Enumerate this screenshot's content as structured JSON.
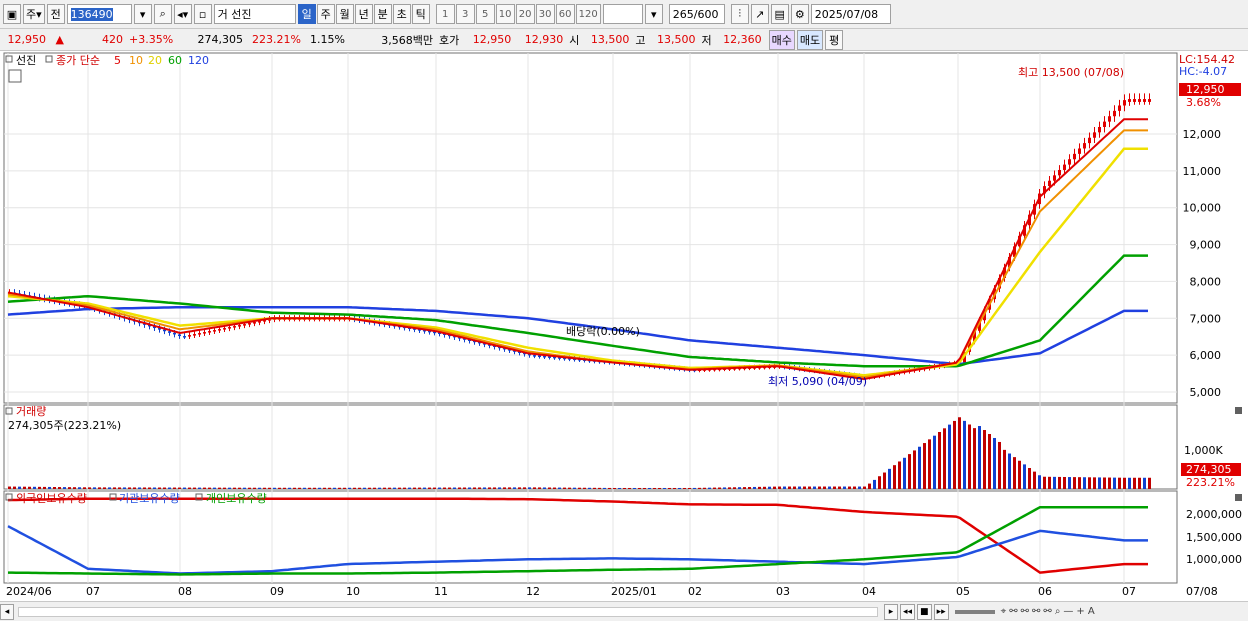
{
  "toolbar": {
    "type_label": "주",
    "prefix_label": "전",
    "code": "136490",
    "name_prefix": "거",
    "name": "선진",
    "period_buttons": [
      "일",
      "주",
      "월",
      "년",
      "분",
      "초",
      "틱"
    ],
    "interval_buttons": [
      "1",
      "3",
      "5",
      "10",
      "20",
      "30",
      "60",
      "120"
    ],
    "count": "265",
    "count_total": "/600",
    "date": "2025/07/08"
  },
  "quote": {
    "price": "12,950",
    "arrow": "▲",
    "change": "420",
    "change_pct": "+3.35%",
    "volume": "274,305",
    "volume_ratio": "223.21%",
    "turnover": "1.15%",
    "amount": "3,568백만",
    "ask_label": "호가",
    "ask1": "12,950",
    "bid1": "12,930",
    "open_label": "시",
    "open": "13,500",
    "high_label": "고",
    "high": "13,500",
    "low_label": "저",
    "low": "12,360",
    "buy_label": "매수",
    "sell_label": "매도",
    "eval_label": "평"
  },
  "legend": {
    "name": "선진",
    "ma_label": "종가 단순",
    "ma_periods": [
      "5",
      "10",
      "20",
      "60",
      "120"
    ],
    "ma_colors": [
      "#e00000",
      "#f09000",
      "#f0e000",
      "#00a000",
      "#2040e0"
    ]
  },
  "annotations": {
    "high": "최고 13,500 (07/08)",
    "low": "최저 5,090 (04/09)",
    "dividend": "배당락(0.00%)",
    "lc": "LC:154.42",
    "hc": "HC:-4.07",
    "last_price": "12,950",
    "last_pct": "3.68%"
  },
  "volume_panel": {
    "title": "거래량",
    "value": "274,305주(223.21%)",
    "tick": "1,000K",
    "last": "274,305",
    "last_pct": "223.21%"
  },
  "holdings_panel": {
    "series": [
      "외국인보유수량",
      "기관보유수량",
      "개인보유수량"
    ],
    "colors": [
      "#e00000",
      "#2050e0",
      "#00a000"
    ],
    "ticks": [
      "2,000,000",
      "1,500,000",
      "1,000,000"
    ]
  },
  "xaxis": {
    "labels": [
      "2024/06",
      "07",
      "08",
      "09",
      "10",
      "11",
      "12",
      "2025/01",
      "02",
      "03",
      "04",
      "05",
      "06",
      "07"
    ],
    "last": "07/08"
  },
  "chart_data": [
    {
      "type": "line",
      "title": "선진",
      "ylim": [
        4700,
        14200
      ],
      "yticks": [
        5000,
        6000,
        7000,
        8000,
        9000,
        10000,
        11000,
        12000
      ],
      "x": [
        "2024/06",
        "07",
        "08",
        "09",
        "10",
        "11",
        "12",
        "2025/01",
        "02",
        "03",
        "04",
        "05",
        "06",
        "07"
      ],
      "series": [
        {
          "name": "종가",
          "values": [
            7700,
            7300,
            6500,
            7000,
            7000,
            6600,
            6000,
            5800,
            5600,
            5700,
            5400,
            5800,
            10500,
            12950
          ]
        },
        {
          "name": "5",
          "values": [
            7700,
            7300,
            6600,
            7000,
            7000,
            6650,
            6050,
            5800,
            5600,
            5700,
            5350,
            5800,
            10300,
            12400
          ]
        },
        {
          "name": "10",
          "values": [
            7650,
            7350,
            6700,
            7000,
            7000,
            6700,
            6100,
            5800,
            5620,
            5720,
            5400,
            5800,
            9900,
            12100
          ]
        },
        {
          "name": "20",
          "values": [
            7600,
            7400,
            6800,
            7000,
            7000,
            6750,
            6200,
            5850,
            5650,
            5720,
            5450,
            5750,
            8800,
            11600
          ]
        },
        {
          "name": "60",
          "values": [
            7450,
            7600,
            7400,
            7150,
            7100,
            6950,
            6600,
            6250,
            5950,
            5800,
            5700,
            5700,
            6400,
            8700
          ]
        },
        {
          "name": "120",
          "values": [
            7100,
            7250,
            7300,
            7300,
            7300,
            7200,
            7000,
            6700,
            6400,
            6200,
            6000,
            5750,
            6050,
            7200
          ]
        }
      ],
      "high": {
        "value": 13500,
        "date": "07/08"
      },
      "low": {
        "value": 5090,
        "date": "04/09"
      }
    },
    {
      "type": "bar",
      "title": "거래량",
      "x": [
        "2024/06",
        "07",
        "08",
        "09",
        "10",
        "11",
        "12",
        "2025/01",
        "02",
        "03",
        "04",
        "05",
        "06",
        "07"
      ],
      "values": [
        60000,
        40000,
        35000,
        30000,
        30000,
        35000,
        40000,
        25000,
        25000,
        60000,
        60000,
        1750000,
        300000,
        274305
      ]
    },
    {
      "type": "line",
      "x": [
        "2024/06",
        "07",
        "08",
        "09",
        "10",
        "11",
        "12",
        "2025/01",
        "02",
        "03",
        "04",
        "05",
        "06",
        "07"
      ],
      "ylim": [
        400000,
        2300000
      ],
      "series": [
        {
          "name": "외국인보유수량",
          "values": [
            2150000,
            2180000,
            2180000,
            2180000,
            2180000,
            2180000,
            2170000,
            2120000,
            2060000,
            2050000,
            1900000,
            1800000,
            620000,
            800000
          ]
        },
        {
          "name": "기관보유수량",
          "values": [
            1600000,
            700000,
            600000,
            650000,
            800000,
            850000,
            900000,
            920000,
            900000,
            850000,
            800000,
            950000,
            1500000,
            1300000
          ]
        },
        {
          "name": "개인보유수량",
          "values": [
            620000,
            600000,
            580000,
            600000,
            600000,
            620000,
            650000,
            680000,
            700000,
            800000,
            900000,
            1050000,
            2000000,
            2000000
          ]
        }
      ]
    }
  ]
}
